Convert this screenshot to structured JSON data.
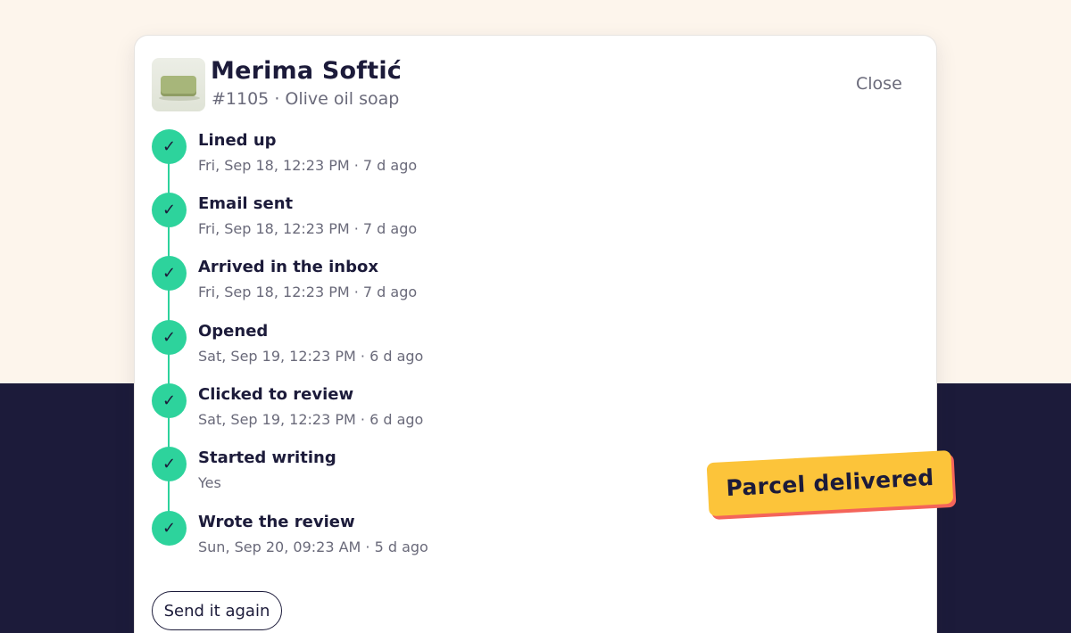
{
  "colors": {
    "background_top": "#fdf5ec",
    "background_bottom": "#1c1b3a",
    "card": "#ffffff",
    "accent_green": "#2dd39c",
    "text_primary": "#1c1b3a",
    "text_muted": "#6a6a7a",
    "sticker_fill": "#fcc43a",
    "sticker_shadow": "#f4645a"
  },
  "header": {
    "name": "Merima Softić",
    "subtitle": "#1105 · Olive oil soap",
    "thumbnail_icon": "soap-product-thumbnail",
    "close_label": "Close"
  },
  "timeline": [
    {
      "title": "Lined up",
      "meta": "Fri, Sep 18, 12:23 PM · 7 d ago",
      "icon": "check-icon"
    },
    {
      "title": "Email sent",
      "meta": "Fri, Sep 18, 12:23 PM · 7 d ago",
      "icon": "check-icon"
    },
    {
      "title": "Arrived in the inbox",
      "meta": "Fri, Sep 18, 12:23 PM · 7 d ago",
      "icon": "check-icon"
    },
    {
      "title": "Opened",
      "meta": "Sat, Sep 19, 12:23 PM · 6 d ago",
      "icon": "check-icon"
    },
    {
      "title": "Clicked to review",
      "meta": "Sat, Sep 19, 12:23 PM · 6 d ago",
      "icon": "check-icon"
    },
    {
      "title": "Started writing",
      "meta": "Yes",
      "icon": "check-icon"
    },
    {
      "title": "Wrote the review",
      "meta": "Sun, Sep 20, 09:23 AM · 5 d ago",
      "icon": "check-icon"
    }
  ],
  "check_glyph": "✓",
  "actions": {
    "resend_label": "Send it again"
  },
  "sticker": {
    "label": "Parcel delivered"
  }
}
